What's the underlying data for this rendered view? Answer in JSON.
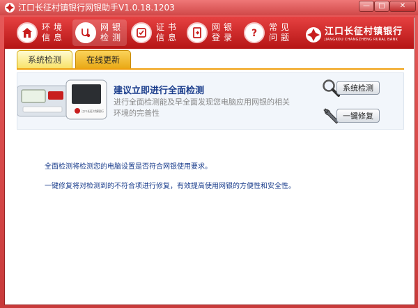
{
  "window": {
    "title": "江口长征村镇银行网银助手V1.0.18.1203",
    "buttons": {
      "minimize": "—",
      "maximize": "□",
      "close": "✕"
    }
  },
  "nav": {
    "items": [
      {
        "label": "环境信息",
        "icon": "home-icon"
      },
      {
        "label": "网银检测",
        "icon": "diagnose-icon",
        "active": true
      },
      {
        "label": "证书信息",
        "icon": "certificate-icon"
      },
      {
        "label": "网银登录",
        "icon": "login-icon"
      },
      {
        "label": "常见问题",
        "icon": "question-icon"
      }
    ]
  },
  "logo": {
    "name_cn": "江口长征村镇银行",
    "name_en": "JIANGKOU CHANGZHENG RURAL BANK"
  },
  "tabs": [
    {
      "label": "系统检测",
      "active": true
    },
    {
      "label": "在线更新",
      "active": false
    }
  ],
  "panel": {
    "title": "建议立即进行全面检测",
    "description": "进行全面检测能及早全面发现您电脑应用网银的相关环境的完善性",
    "device_label": "江口长征村镇银行",
    "actions": [
      {
        "label": "系统检测",
        "icon": "magnifier-icon"
      },
      {
        "label": "一键修复",
        "icon": "wrench-icon"
      }
    ]
  },
  "info": [
    "全面检测将检测您的电脑设置是否符合网银使用要求。",
    "一键修复将对检测到的不符合项进行修复，有效提高使用网银的方便性和安全性。"
  ],
  "colors": {
    "brand": "#c81e1e",
    "accent": "#f0a010",
    "text_blue": "#1a3d8c"
  }
}
